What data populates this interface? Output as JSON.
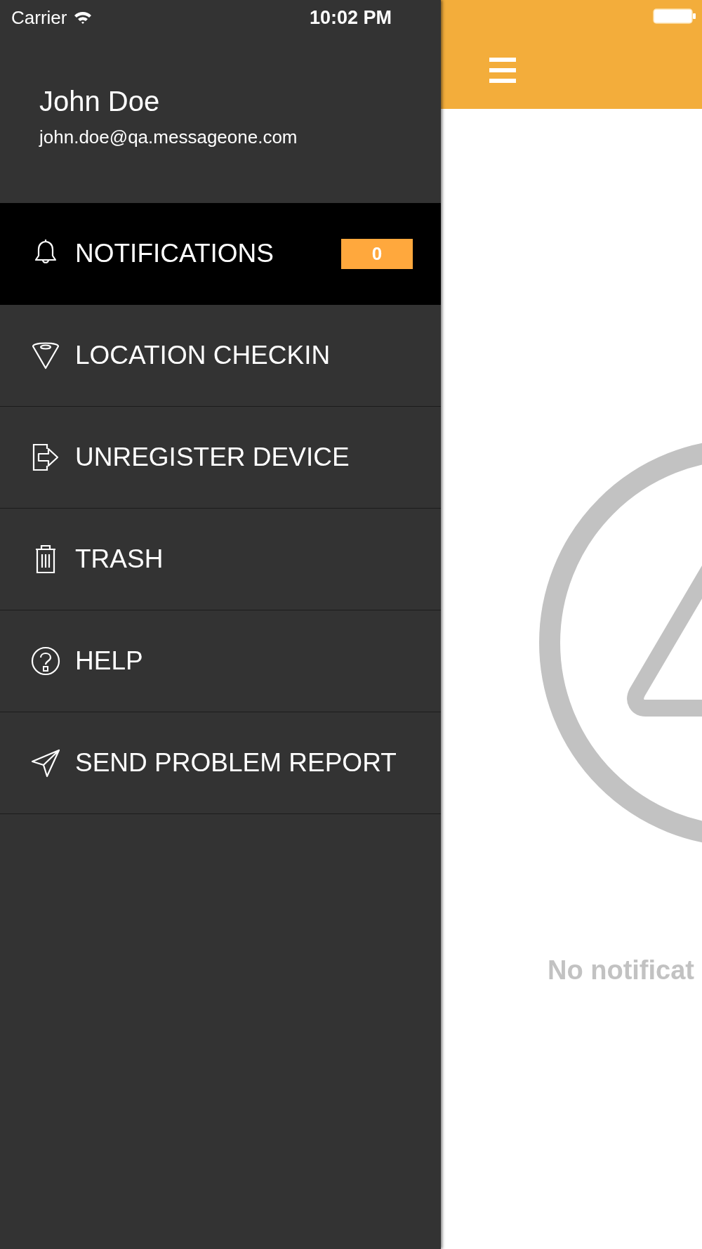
{
  "status_bar": {
    "carrier": "Carrier",
    "time": "10:02 PM"
  },
  "drawer": {
    "user_name": "John Doe",
    "email": "john.doe@qa.messageone.com",
    "items": [
      {
        "kind": "bell",
        "label": "NOTIFICATIONS",
        "badge": "0",
        "selected": true
      },
      {
        "kind": "location",
        "label": "LOCATION CHECKIN",
        "selected": false
      },
      {
        "kind": "exit",
        "label": "UNREGISTER DEVICE",
        "selected": false
      },
      {
        "kind": "trash",
        "label": "TRASH",
        "selected": false
      },
      {
        "kind": "help",
        "label": "HELP",
        "selected": false
      },
      {
        "kind": "send",
        "label": "SEND PROBLEM REPORT",
        "selected": false
      }
    ]
  },
  "main": {
    "empty_message": "No notificat"
  }
}
